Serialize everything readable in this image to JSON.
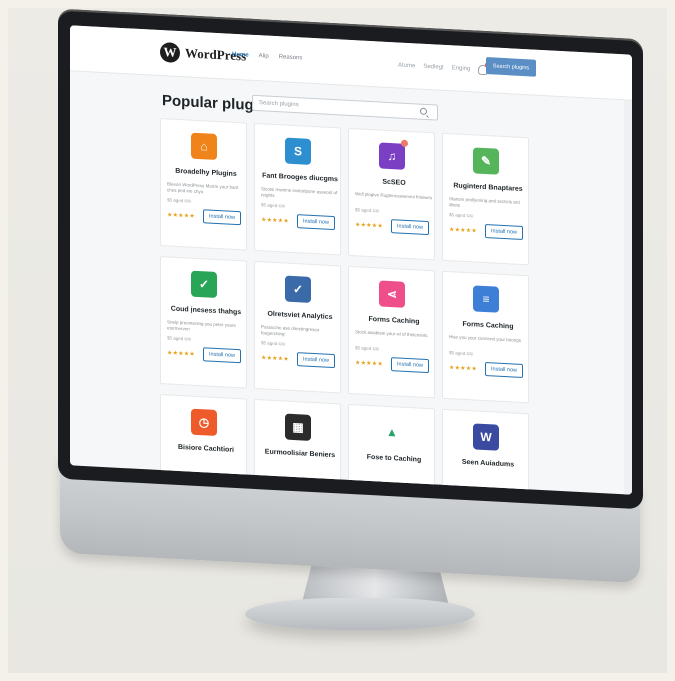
{
  "header": {
    "logo_text": "WordPress",
    "nav": [
      "Home",
      "Alip",
      "Reasons"
    ],
    "right_links": [
      "Atume",
      "Sedlegt",
      "Enging"
    ],
    "cta": "Search plugins"
  },
  "main": {
    "title": "Popular plugins",
    "search_placeholder": "Search plugins"
  },
  "plugins": [
    {
      "name": "Broadelhy Plugins",
      "desc": "Bleeon WordPress Monm your bant ches ped ine chyo",
      "meta": "$5 aged ©©",
      "stars": "★★★★★",
      "button": "Install now",
      "color": "#f0841b",
      "icon": "home-icon"
    },
    {
      "name": "Fant Brooges diucgms",
      "desc": "Sicotsi rnwnine invitorlpone asseost of reights",
      "meta": "$5 aged ©©",
      "stars": "★★★★★",
      "button": "Install now",
      "color": "#2e8fd0",
      "icon": "seo-icon"
    },
    {
      "name": "ScSEO",
      "desc": "Well plogive Rugtnnesswevmi fnisiwes",
      "meta": "$5 aged ©©",
      "stars": "★★★★★",
      "button": "Install now",
      "color": "#7b3fc4",
      "icon": "music-icon"
    },
    {
      "name": "Ruginterd Bnaptares",
      "desc": "Stansm prollyening and secticls ard dbots",
      "meta": "$5 aged ©©",
      "stars": "★★★★★",
      "button": "Install now",
      "color": "#56b55b",
      "icon": "form-icon"
    },
    {
      "name": "Coud įnesess thahgs",
      "desc": "Snelp preentening you peter youre etormerven",
      "meta": "$5 aged ©©",
      "stars": "★★★★★",
      "button": "Install now",
      "color": "#29a557",
      "icon": "shield-check-icon"
    },
    {
      "name": "Olretsviet Analytics",
      "desc": "Possicche ase directingresco fougerching'",
      "meta": "$5 aged ©©",
      "stars": "★★★★★",
      "button": "Install now",
      "color": "#3a6aa8",
      "icon": "shield-check-icon"
    },
    {
      "name": "Forms Caching",
      "desc": "Stock aisabiste your wl of thelemints",
      "meta": "$5 aged ©©",
      "stars": "★★★★★",
      "button": "Install now",
      "color": "#ee4f8b",
      "icon": "share-icon"
    },
    {
      "name": "Forms Caching",
      "desc": "Hise you your connend your boongs",
      "meta": "$5 aged ©©",
      "stars": "★★★★★",
      "button": "Install now",
      "color": "#3d7ed6",
      "icon": "list-icon"
    },
    {
      "name": "Bisiore Cachtiori",
      "desc": "",
      "meta": "",
      "stars": "",
      "button": "",
      "color": "#ef5a2a",
      "icon": "clock-icon"
    },
    {
      "name": "Eurmoolisiar Beniers",
      "desc": "",
      "meta": "",
      "stars": "",
      "button": "",
      "color": "#2b2b2b",
      "icon": "dashboard-icon"
    },
    {
      "name": "Fose to Caching",
      "desc": "",
      "meta": "",
      "stars": "",
      "button": "",
      "color": "#ffffff",
      "icon": "triangle-icon"
    },
    {
      "name": "Seen Auiadums",
      "desc": "",
      "meta": "",
      "stars": "",
      "button": "",
      "color": "#3a4aa0",
      "icon": "wordpress-icon"
    }
  ]
}
